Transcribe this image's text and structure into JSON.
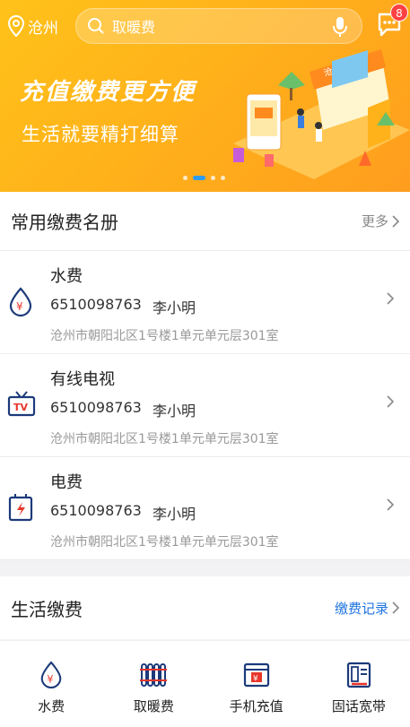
{
  "topbar": {
    "location": "沧州",
    "search_placeholder": "取暖费",
    "message_count": "8"
  },
  "banner": {
    "slogan_main": "充值缴费更方便",
    "slogan_sub": "生活就要精打细算",
    "shop_sign": "沧州银行",
    "slide_count": 4,
    "active_slide": 1
  },
  "frequent": {
    "title": "常用缴费名册",
    "more_label": "更多",
    "items": [
      {
        "icon": "water-drop-icon",
        "name": "水费",
        "account": "6510098763",
        "user": "李小明",
        "address": "沧州市朝阳北区1号楼1单元单元层301室"
      },
      {
        "icon": "tv-icon",
        "name": "有线电视",
        "account": "6510098763",
        "user": "李小明",
        "address": "沧州市朝阳北区1号楼1单元单元层301室"
      },
      {
        "icon": "electricity-icon",
        "name": "电费",
        "account": "6510098763",
        "user": "李小明",
        "address": "沧州市朝阳北区1号楼1单元单元层301室"
      }
    ]
  },
  "life": {
    "title": "生活缴费",
    "record_label": "缴费记录",
    "items": [
      {
        "icon": "water-drop-icon",
        "label": "水费"
      },
      {
        "icon": "radiator-icon",
        "label": "取暖费"
      },
      {
        "icon": "phone-topup-icon",
        "label": "手机充值"
      },
      {
        "icon": "landline-icon",
        "label": "固话宽带"
      }
    ]
  },
  "colors": {
    "banner": "#ffb21a",
    "accent_blue": "#1f74e0",
    "icon_navy": "#1c3a7a",
    "icon_red": "#e8352b"
  }
}
